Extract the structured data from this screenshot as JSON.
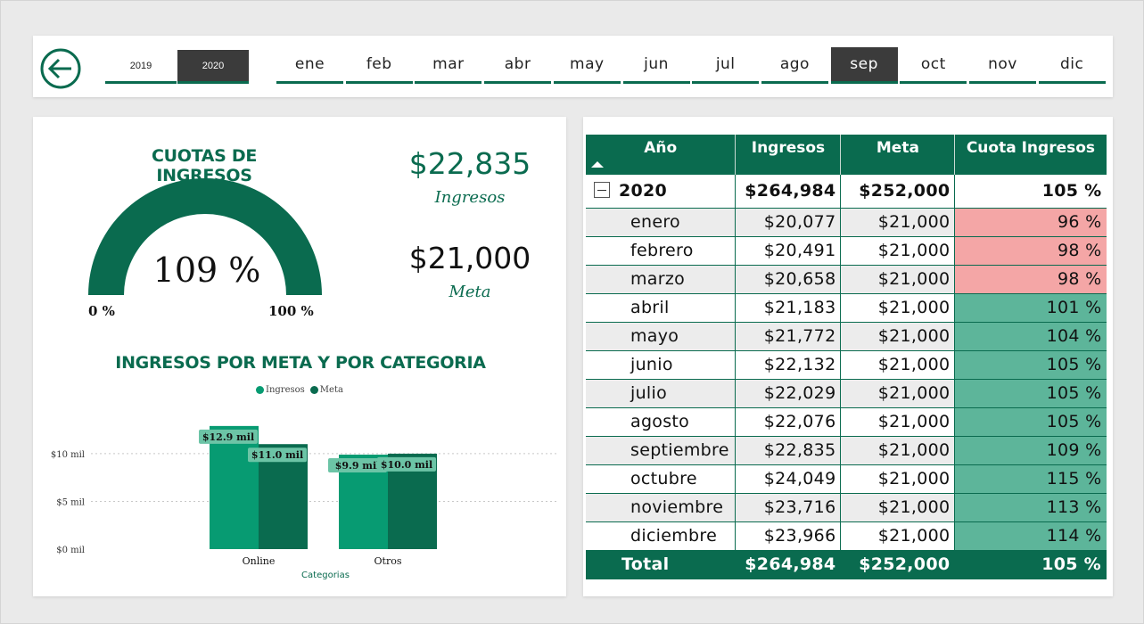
{
  "nav": {
    "years": [
      "2019",
      "2020"
    ],
    "active_year": "2020",
    "months": [
      "ene",
      "feb",
      "mar",
      "abr",
      "may",
      "jun",
      "jul",
      "ago",
      "sep",
      "oct",
      "nov",
      "dic"
    ],
    "active_month": "sep"
  },
  "gauge": {
    "title": "CUOTAS DE INGRESOS",
    "value_label": "109 %",
    "value": 1.09,
    "min_label": "0 %",
    "max_label": "100 %"
  },
  "kpis": {
    "ingresos_value": "$22,835",
    "ingresos_label": "Ingresos",
    "meta_value": "$21,000",
    "meta_label": "Meta"
  },
  "chart": {
    "title": "INGRESOS POR META Y POR CATEGORIA",
    "legend_ingresos": "Ingresos",
    "legend_meta": "Meta",
    "xaxis_label": "Categorias"
  },
  "chart_data": {
    "type": "bar",
    "title": "INGRESOS POR META Y POR CATEGORIA",
    "xlabel": "Categorias",
    "ylabel": "",
    "categories": [
      "Online",
      "Otros"
    ],
    "series": [
      {
        "name": "Ingresos",
        "values": [
          12.9,
          9.9
        ],
        "labels": [
          "$12.9 mil",
          "$9.9 mil"
        ],
        "color": "#079b72"
      },
      {
        "name": "Meta",
        "values": [
          11.0,
          10.0
        ],
        "labels": [
          "$11.0 mil",
          "$10.0 mil"
        ],
        "color": "#0a6b4f"
      }
    ],
    "yticks": [
      0,
      5,
      10
    ],
    "ytick_labels": [
      "$0 mil",
      "$5 mil",
      "$10 mil"
    ],
    "ylim": [
      0,
      13
    ],
    "grid": true,
    "legend_position": "top"
  },
  "table": {
    "headers": [
      "Año",
      "Ingresos",
      "Meta",
      "Cuota Ingresos"
    ],
    "year_row": {
      "year": "2020",
      "ingresos": "$264,984",
      "meta": "$252,000",
      "cuota": "105 %"
    },
    "rows": [
      {
        "mes": "enero",
        "ingresos": "$20,077",
        "meta": "$21,000",
        "cuota": "96 %",
        "status": "low"
      },
      {
        "mes": "febrero",
        "ingresos": "$20,491",
        "meta": "$21,000",
        "cuota": "98 %",
        "status": "low"
      },
      {
        "mes": "marzo",
        "ingresos": "$20,658",
        "meta": "$21,000",
        "cuota": "98 %",
        "status": "low"
      },
      {
        "mes": "abril",
        "ingresos": "$21,183",
        "meta": "$21,000",
        "cuota": "101 %",
        "status": "high"
      },
      {
        "mes": "mayo",
        "ingresos": "$21,772",
        "meta": "$21,000",
        "cuota": "104 %",
        "status": "high"
      },
      {
        "mes": "junio",
        "ingresos": "$22,132",
        "meta": "$21,000",
        "cuota": "105 %",
        "status": "high"
      },
      {
        "mes": "julio",
        "ingresos": "$22,029",
        "meta": "$21,000",
        "cuota": "105 %",
        "status": "high"
      },
      {
        "mes": "agosto",
        "ingresos": "$22,076",
        "meta": "$21,000",
        "cuota": "105 %",
        "status": "high"
      },
      {
        "mes": "septiembre",
        "ingresos": "$22,835",
        "meta": "$21,000",
        "cuota": "109 %",
        "status": "high"
      },
      {
        "mes": "octubre",
        "ingresos": "$24,049",
        "meta": "$21,000",
        "cuota": "115 %",
        "status": "high"
      },
      {
        "mes": "noviembre",
        "ingresos": "$23,716",
        "meta": "$21,000",
        "cuota": "113 %",
        "status": "high"
      },
      {
        "mes": "diciembre",
        "ingresos": "$23,966",
        "meta": "$21,000",
        "cuota": "114 %",
        "status": "high"
      }
    ],
    "total_row": {
      "label": "Total",
      "ingresos": "$264,984",
      "meta": "$252,000",
      "cuota": "105 %"
    }
  },
  "colors": {
    "brand_green": "#0a6b4f",
    "ingresos_green": "#079b72",
    "low_red": "#f4a6a6",
    "high_green": "#5db59a",
    "active_tab": "#3b3b3b"
  }
}
